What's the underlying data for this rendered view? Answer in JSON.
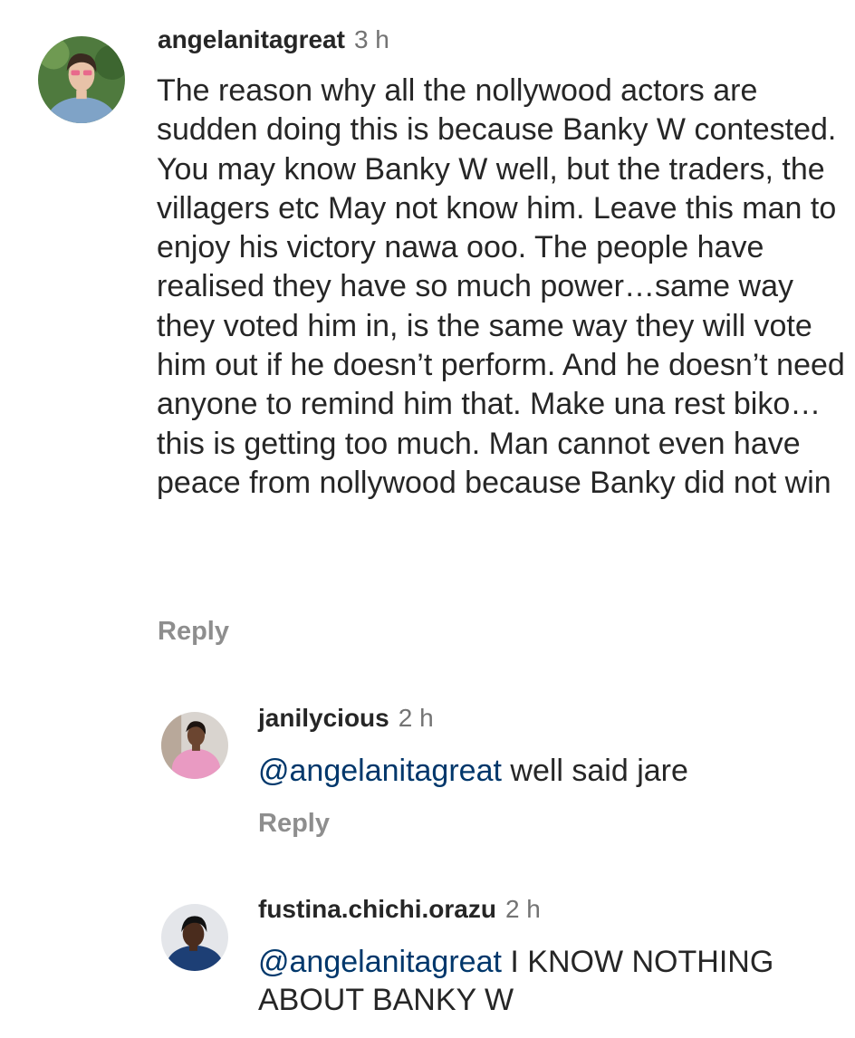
{
  "comment": {
    "username": "angelanitagreat",
    "time": "3 h",
    "text": "The reason why all the nollywood actors are sudden doing this is because Banky W contested. You may know Banky W well, but the traders, the villagers etc May not know him. Leave this man to enjoy his victory nawa ooo. The people have realised they have so much power…same way they voted him in, is the same way they will vote him out if he doesn’t perform. And he doesn’t need anyone to remind him that. Make una rest biko…this is getting too much. Man cannot even have peace from nollywood because Banky did not win",
    "reply_label": "Reply",
    "avatar_icon": "profile-photo-woman-pink-sunglasses"
  },
  "replies": [
    {
      "username": "janilycious",
      "time": "2 h",
      "mention": "@angelanitagreat",
      "text": " well said jare",
      "reply_label": "Reply",
      "avatar_icon": "profile-photo-woman-pink-dress"
    },
    {
      "username": "fustina.chichi.orazu",
      "time": "2 h",
      "mention": "@angelanitagreat",
      "text": " I KNOW NOTHING ABOUT BANKY W",
      "avatar_icon": "profile-photo-woman-dark-outfit"
    }
  ],
  "colors": {
    "text": "#262626",
    "mention": "#00376b",
    "secondary": "#737373",
    "reply": "#8e8e8e"
  }
}
